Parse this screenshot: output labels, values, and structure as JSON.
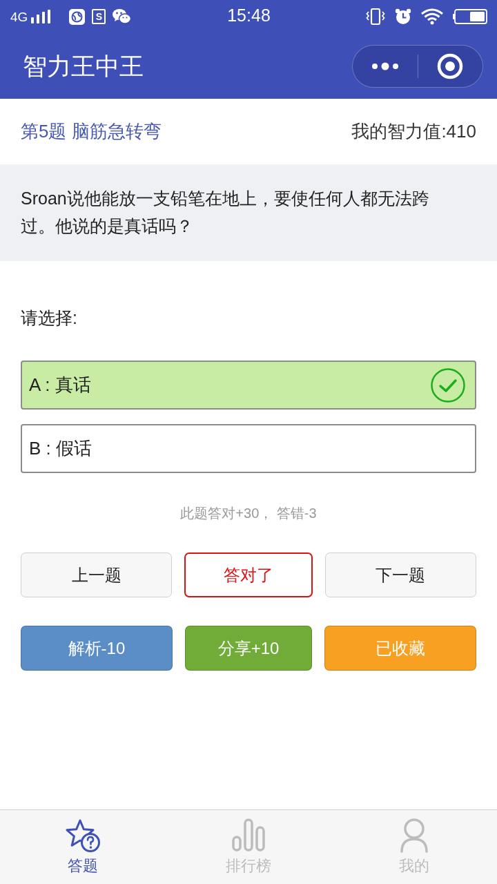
{
  "status_bar": {
    "network": "4G",
    "notification_letter": "S",
    "time": "15:48"
  },
  "nav_bar": {
    "title": "智力王中王"
  },
  "header": {
    "question_label": "第5题 脑筋急转弯",
    "score": "我的智力值:410"
  },
  "question": {
    "text": "Sroan说他能放一支铅笔在地上，要使任何人都无法跨过。他说的是真话吗？"
  },
  "prompt": "请选择:",
  "options": [
    {
      "label": "A : 真话",
      "selected": true
    },
    {
      "label": "B : 假话",
      "selected": false
    }
  ],
  "hint": "此题答对+30， 答错-3",
  "answer_buttons": [
    {
      "label": "上一题",
      "kind": "plain"
    },
    {
      "label": "答对了",
      "kind": "result"
    },
    {
      "label": "下一题",
      "kind": "plain"
    }
  ],
  "action_buttons": [
    {
      "label": "解析-10",
      "color": "#5b8dc7"
    },
    {
      "label": "分享+10",
      "color": "#72ac38"
    },
    {
      "label": "已收藏",
      "color": "#f7a021"
    }
  ],
  "tab_bar": [
    {
      "label": "答题",
      "selected": true
    },
    {
      "label": "排行榜",
      "selected": false
    },
    {
      "label": "我的",
      "selected": false
    }
  ]
}
